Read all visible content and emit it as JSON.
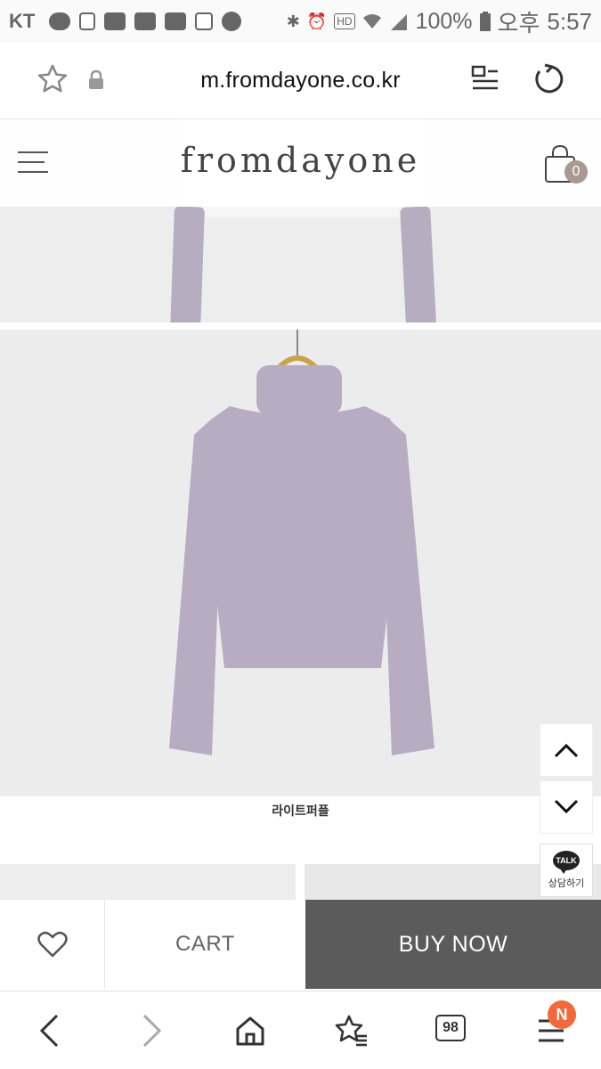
{
  "status_bar": {
    "carrier": "KT",
    "battery_percent": "100%",
    "time_period": "오후",
    "time": "5:57"
  },
  "browser": {
    "url": "m.fromdayone.co.kr",
    "tab_count": "98",
    "notification_badge": "N"
  },
  "site": {
    "logo": "fromdayone",
    "cart_count": "0"
  },
  "product": {
    "color_caption": "라이트퍼플",
    "sweater_color": "#b8acc3"
  },
  "floating": {
    "talk_icon_text": "TALK",
    "talk_label": "상담하기"
  },
  "actions": {
    "cart_label": "CART",
    "buy_label": "BUY NOW"
  }
}
